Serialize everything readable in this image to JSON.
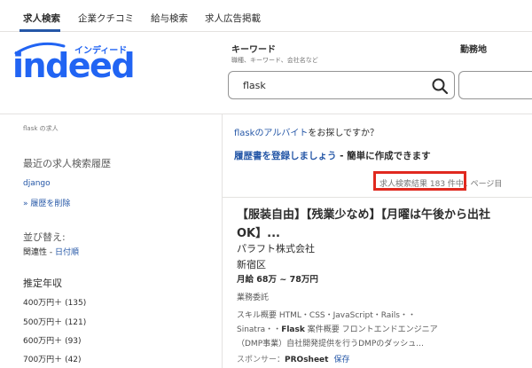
{
  "nav": {
    "tabs": [
      {
        "label": "求人検索",
        "active": true
      },
      {
        "label": "企業クチコミ",
        "active": false
      },
      {
        "label": "給与検索",
        "active": false
      },
      {
        "label": "求人広告掲載",
        "active": false
      }
    ]
  },
  "logo": {
    "kana": "インディード",
    "word": "indeed"
  },
  "search": {
    "keyword_label": "キーワード",
    "keyword_sub": "職種、キーワード、会社名など",
    "keyword_value": "flask",
    "location_label": "勤務地"
  },
  "sidebar": {
    "query_label": "flask の求人",
    "history_title": "最近の求人検索履歴",
    "history_items": [
      "django"
    ],
    "delete_history": "» 履歴を削除",
    "sort_title": "並び替え:",
    "sort_current": "関連性",
    "sort_separator": " - ",
    "sort_option": "日付順",
    "salary_title": "推定年収",
    "salary_items": [
      {
        "label": "400万円＋",
        "count": "(135)"
      },
      {
        "label": "500万円＋",
        "count": "(121)"
      },
      {
        "label": "600万円＋",
        "count": "(93)"
      },
      {
        "label": "700万円＋",
        "count": "(42)"
      }
    ]
  },
  "results": {
    "prompt_keyword": "flask",
    "prompt_link": "のアルバイト",
    "prompt_rest": "をお探しですか？",
    "resume_link": "履歴書を登録しましょう",
    "resume_rest": " - 簡単に作成できます",
    "count_text": "求人検索結果 183 件中",
    "count_after": "1 ページ目"
  },
  "job": {
    "title": "【服装自由】【残業少なめ】【月曜は午後から出社OK】...",
    "company": "パラフト株式会社",
    "location": "新宿区",
    "salary": "月給 68万 ~ 78万円",
    "employment_type": "業務委託",
    "snippet_1": "スキル概要 HTML・CSS・JavaScript・Rails・・",
    "snippet_2a": "Sinatra・・",
    "snippet_2b": "Flask",
    "snippet_2c": " 案件概要 フロントエンドエンジニア",
    "snippet_3": "（DMP事業）自社開発提供を行うDMPのダッシュ...",
    "sponsor_label": "スポンサー：",
    "sponsor_company": "PROsheet",
    "save_label": "保存"
  },
  "colors": {
    "brand": "#2164f3",
    "link": "#2557a7",
    "highlight": "#e0291f"
  }
}
